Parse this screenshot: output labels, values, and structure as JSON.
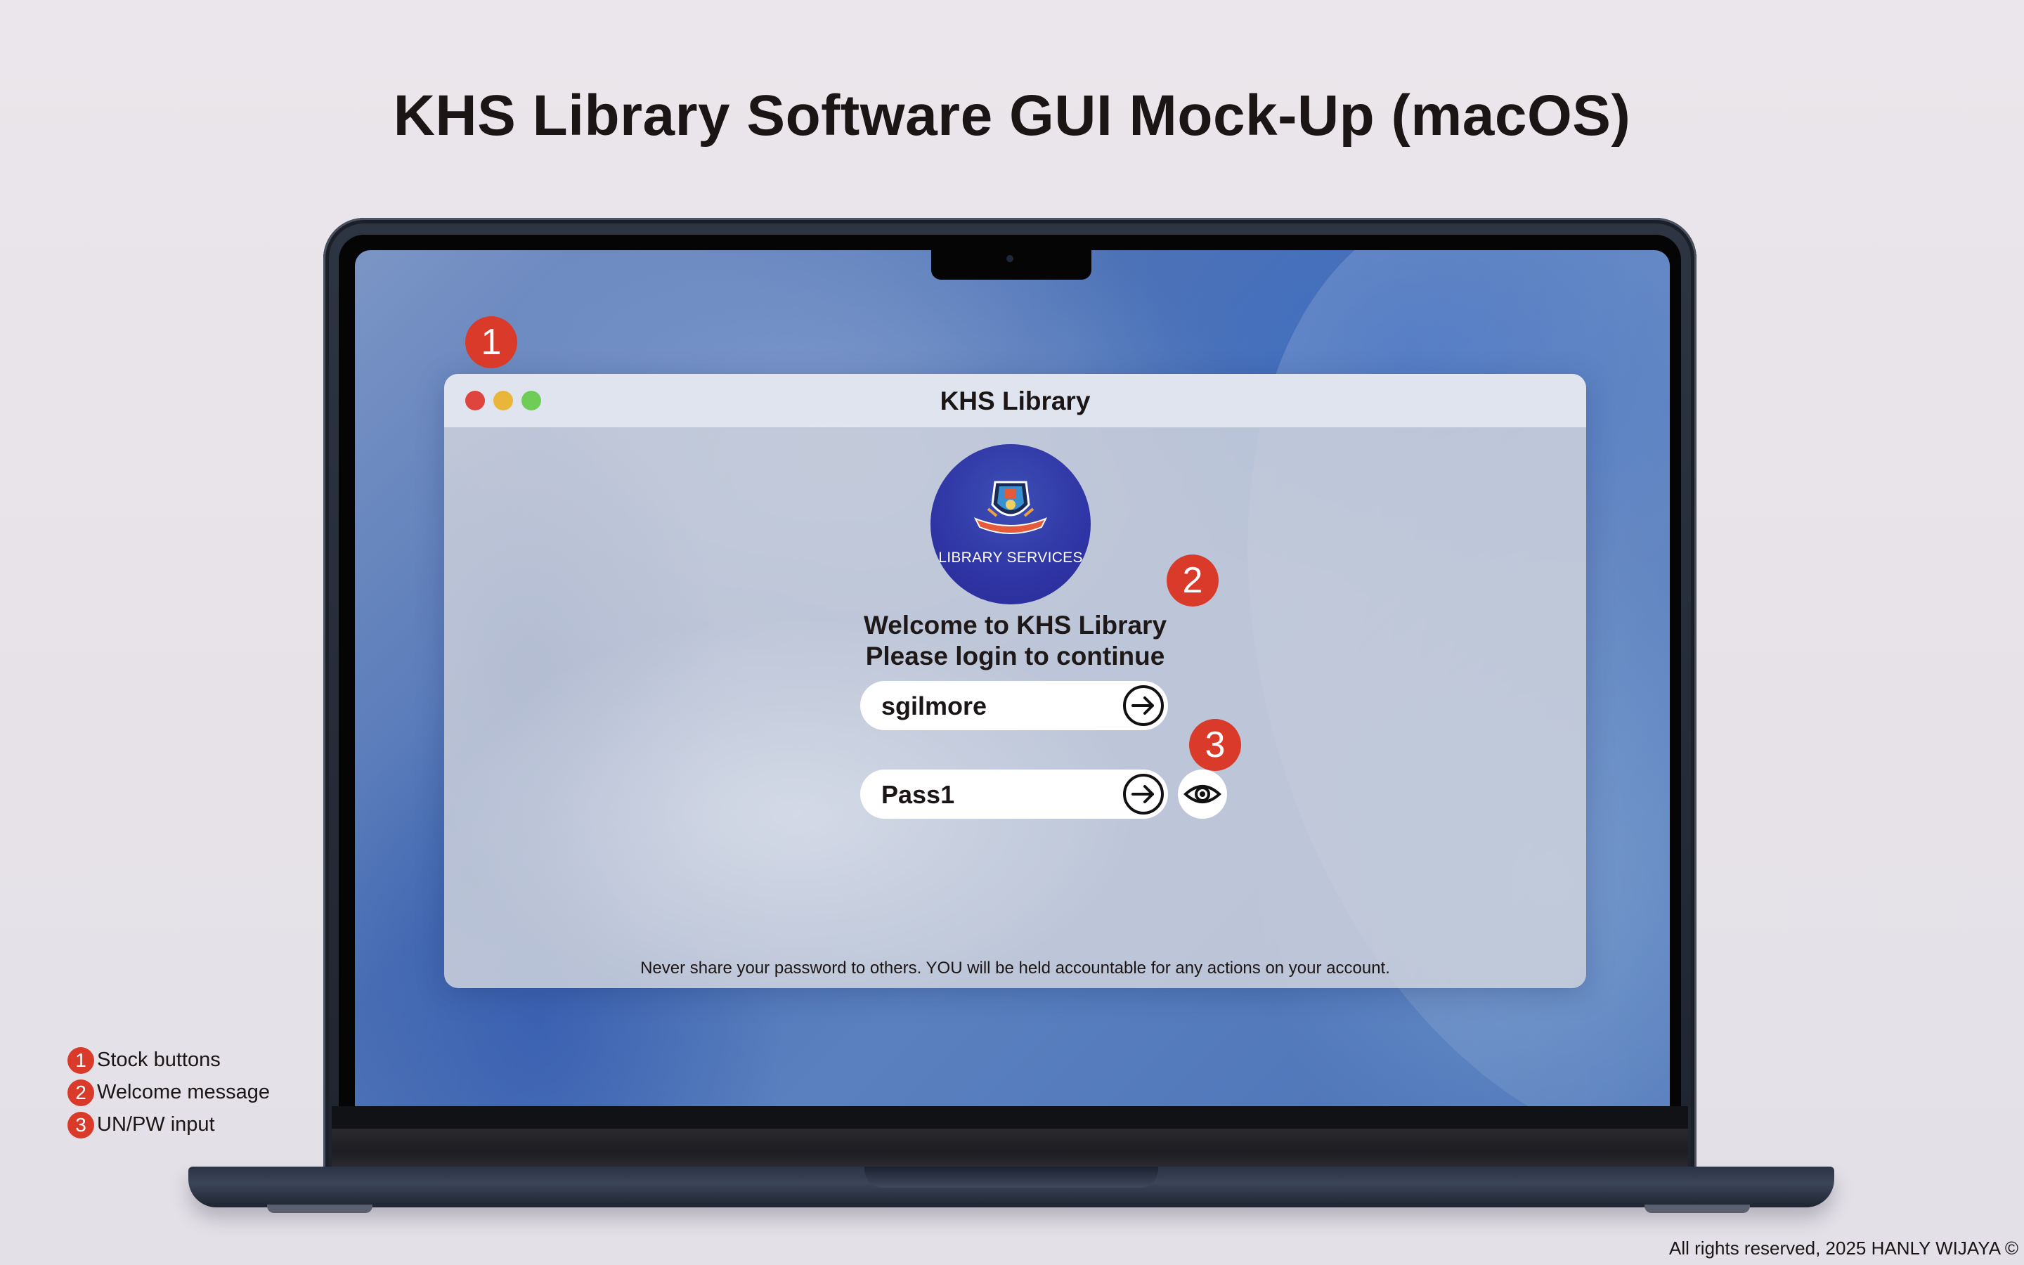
{
  "page": {
    "title": "KHS Library Software GUI Mock-Up (macOS)",
    "copyright": "All rights reserved, 2025 HANLY WIJAYA ©"
  },
  "window": {
    "title": "KHS Library",
    "traffic_lights": [
      "close",
      "minimize",
      "maximize"
    ]
  },
  "logo": {
    "label": "LIBRARY SERVICES"
  },
  "welcome": {
    "line1": "Welcome to KHS Library",
    "line2": "Please login to continue"
  },
  "login": {
    "username_value": "sgilmore",
    "password_value": "Pass1",
    "submit_icon": "arrow-right-circle-icon",
    "show_password_icon": "eye-icon"
  },
  "warning": "Never share your password to others. YOU will be held accountable for any actions on your account.",
  "markers": [
    "1",
    "2",
    "3"
  ],
  "legend": [
    {
      "number": "1",
      "label": "Stock buttons"
    },
    {
      "number": "2",
      "label": "Welcome message"
    },
    {
      "number": "3",
      "label": "UN/PW input"
    }
  ],
  "colors": {
    "marker": "#d93a2a",
    "logo_bg": "#2f35a5",
    "close": "#e0443e",
    "minimize": "#e9b63a",
    "maximize": "#6fcc57"
  }
}
